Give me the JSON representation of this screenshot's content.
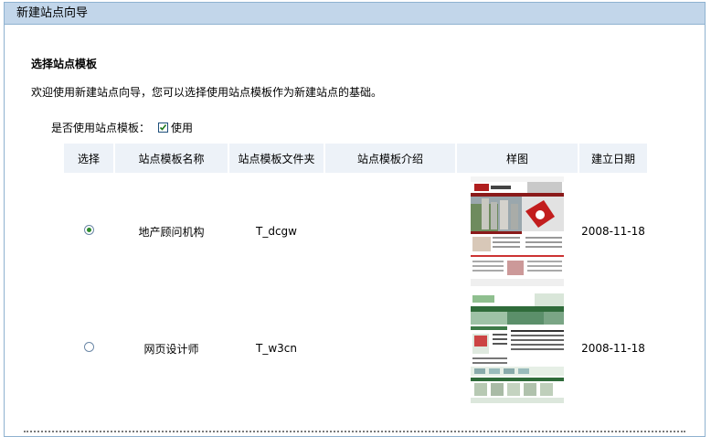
{
  "header": {
    "title": "新建站点向导"
  },
  "section": {
    "title": "选择站点模板",
    "intro": "欢迎使用新建站点向导，您可以选择使用站点模板作为新建站点的基础。"
  },
  "use_template": {
    "label": "是否使用站点模板：",
    "option": "使用",
    "checked": true
  },
  "table": {
    "headers": [
      "选择",
      "站点模板名称",
      "站点模板文件夹",
      "站点模板介绍",
      "样图",
      "建立日期"
    ],
    "rows": [
      {
        "selected": true,
        "name": "地产顾问机构",
        "folder": "T_dcgw",
        "intro": "",
        "date": "2008-11-18"
      },
      {
        "selected": false,
        "name": "网页设计师",
        "folder": "T_w3cn",
        "intro": "",
        "date": "2008-11-18"
      }
    ]
  },
  "colors": {
    "header_bg": "#c2d6ea",
    "border": "#8fb2d0",
    "th_bg": "#edf2f8",
    "radio_dot": "#2d8a2d"
  }
}
